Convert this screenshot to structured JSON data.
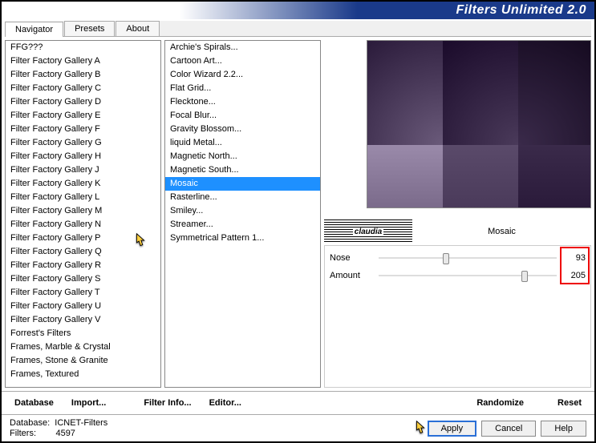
{
  "title": "Filters Unlimited 2.0",
  "tabs": {
    "navigator": "Navigator",
    "presets": "Presets",
    "about": "About"
  },
  "categories": [
    "FFG???",
    "Filter Factory Gallery A",
    "Filter Factory Gallery B",
    "Filter Factory Gallery C",
    "Filter Factory Gallery D",
    "Filter Factory Gallery E",
    "Filter Factory Gallery F",
    "Filter Factory Gallery G",
    "Filter Factory Gallery H",
    "Filter Factory Gallery J",
    "Filter Factory Gallery K",
    "Filter Factory Gallery L",
    "Filter Factory Gallery M",
    "Filter Factory Gallery N",
    "Filter Factory Gallery P",
    "Filter Factory Gallery Q",
    "Filter Factory Gallery R",
    "Filter Factory Gallery S",
    "Filter Factory Gallery T",
    "Filter Factory Gallery U",
    "Filter Factory Gallery V",
    "Forrest's Filters",
    "Frames, Marble & Crystal",
    "Frames, Stone & Granite",
    "Frames, Textured"
  ],
  "filters": [
    "Archie's Spirals...",
    "Cartoon Art...",
    "Color Wizard 2.2...",
    "Flat Grid...",
    "Flecktone...",
    "Focal Blur...",
    "Gravity Blossom...",
    "liquid Metal...",
    "Magnetic North...",
    "Magnetic South...",
    "Mosaic",
    "Rasterline...",
    "Smiley...",
    "Streamer...",
    "Symmetrical Pattern 1..."
  ],
  "selected_filter_index": 10,
  "filter_name": "Mosaic",
  "logo_text": "claudia",
  "params": [
    {
      "label": "Nose",
      "value": "93",
      "thumb_pct": 36
    },
    {
      "label": "Amount",
      "value": "205",
      "thumb_pct": 80
    }
  ],
  "buttons": {
    "database": "Database",
    "import": "Import...",
    "filter_info": "Filter Info...",
    "editor": "Editor...",
    "randomize": "Randomize",
    "reset": "Reset",
    "apply": "Apply",
    "cancel": "Cancel",
    "help": "Help"
  },
  "status": {
    "db_label": "Database:",
    "db_value": "ICNET-Filters",
    "filters_label": "Filters:",
    "filters_value": "4597"
  }
}
